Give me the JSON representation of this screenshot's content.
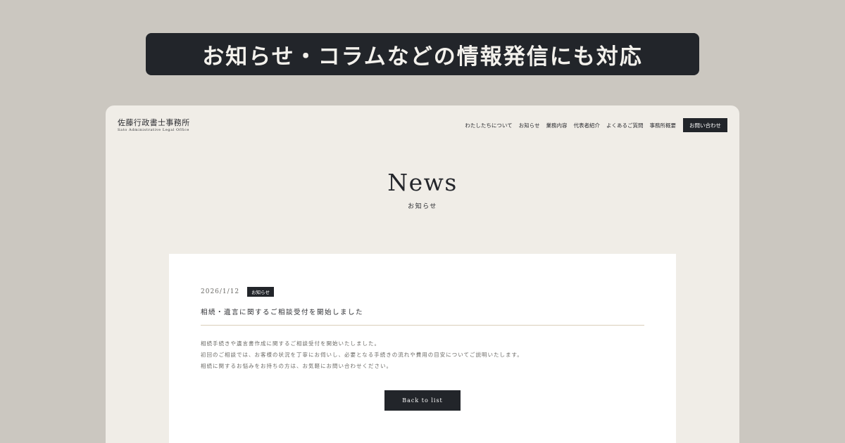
{
  "banner": {
    "text": "お知らせ・コラムなどの情報発信にも対応"
  },
  "site": {
    "logo_jp": "佐藤行政書士事務所",
    "logo_en": "Sato Administrative Legal Office"
  },
  "nav": {
    "items": [
      {
        "label": "わたしたちについて"
      },
      {
        "label": "お知らせ"
      },
      {
        "label": "業務内容"
      },
      {
        "label": "代表者紹介"
      },
      {
        "label": "よくあるご質問"
      },
      {
        "label": "事務所概要"
      }
    ],
    "cta_label": "お問い合わせ"
  },
  "hero": {
    "title": "News",
    "subtitle": "お知らせ"
  },
  "post": {
    "date": "2026/1/12",
    "category": "お知らせ",
    "title": "相続・遺言に関するご相談受付を開始しました",
    "body": [
      "相続手続きや遺言書作成に関するご相談受付を開始いたしました。",
      "初回のご相談では、お客様の状況を丁寧にお伺いし、必要となる手続きの流れや費用の目安についてご説明いたします。",
      "相続に関するお悩みをお持ちの方は、お気軽にお問い合わせください。"
    ],
    "back_label": "Back to list"
  },
  "colors": {
    "background": "#cbc7c0",
    "panel": "#f0ede7",
    "dark": "#22252a",
    "card": "#ffffff",
    "divider": "#d9cdb9"
  }
}
